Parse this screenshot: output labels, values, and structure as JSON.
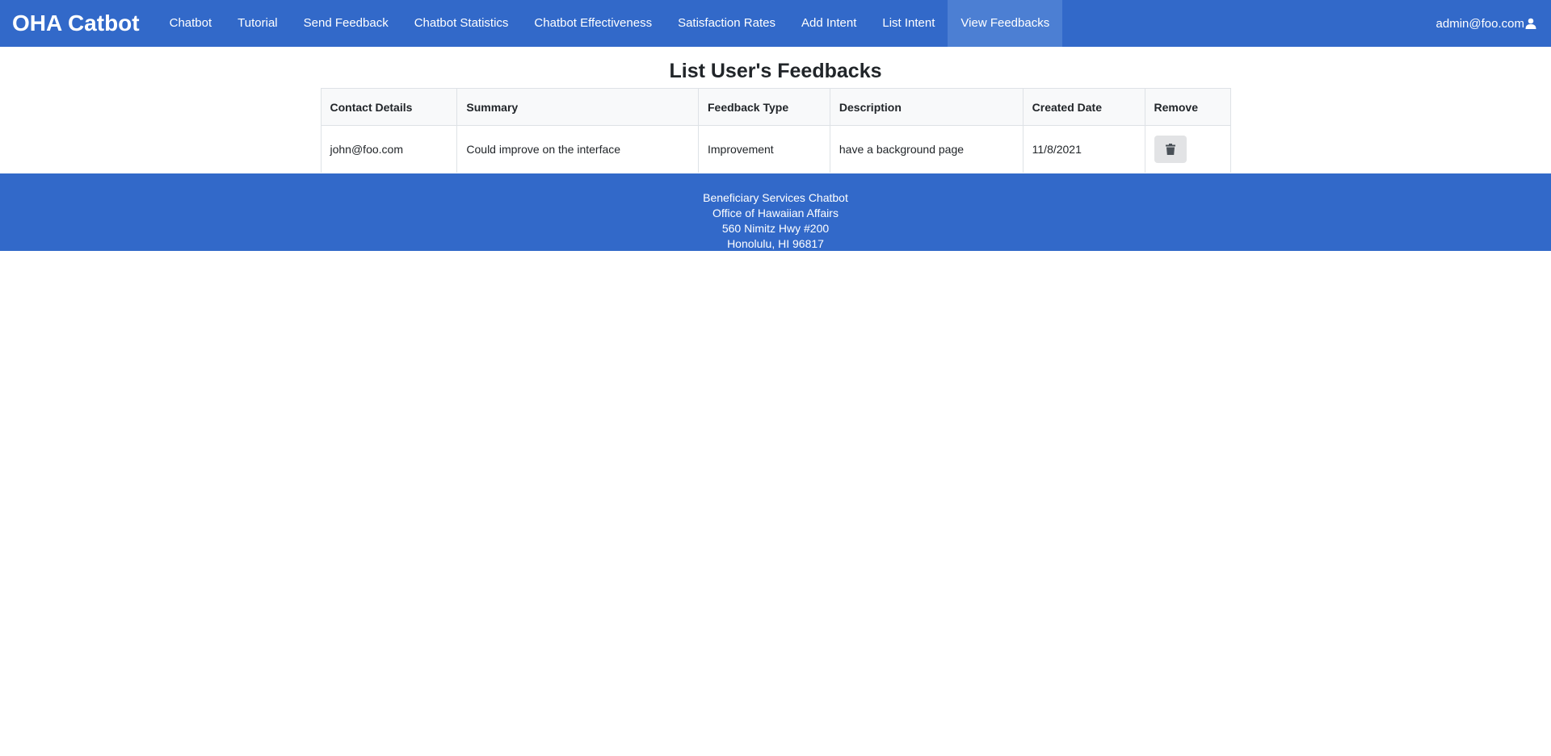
{
  "navbar": {
    "brand": "OHA Catbot",
    "items": [
      {
        "label": "Chatbot"
      },
      {
        "label": "Tutorial"
      },
      {
        "label": "Send Feedback"
      },
      {
        "label": "Chatbot Statistics"
      },
      {
        "label": "Chatbot Effectiveness"
      },
      {
        "label": "Satisfaction Rates"
      },
      {
        "label": "Add Intent"
      },
      {
        "label": "List Intent"
      },
      {
        "label": "View Feedbacks",
        "active": true
      }
    ],
    "user": "admin@foo.com",
    "user_icon": "user-icon"
  },
  "main": {
    "title": "List User's Feedbacks",
    "table": {
      "headers": [
        "Contact Details",
        "Summary",
        "Feedback Type",
        "Description",
        "Created Date",
        "Remove"
      ],
      "rows": [
        {
          "contact": "john@foo.com",
          "summary": "Could improve on the interface",
          "type": "Improvement",
          "description": "have a background page",
          "created": "11/8/2021",
          "remove_icon": "trash-icon"
        }
      ]
    }
  },
  "footer": {
    "line1": "Beneficiary Services Chatbot",
    "line2": "Office of Hawaiian Affairs",
    "line3": "560 Nimitz Hwy #200",
    "line4": "Honolulu, HI 96817"
  },
  "colors": {
    "primary": "#3269c9",
    "active_nav": "#4c7fd3",
    "button_bg": "#e2e3e5"
  }
}
